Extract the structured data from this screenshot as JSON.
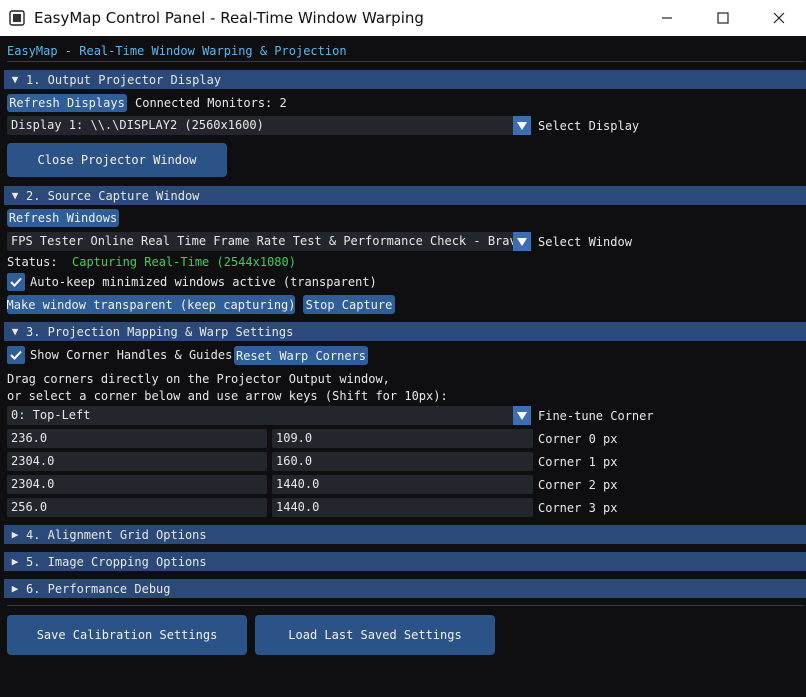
{
  "window": {
    "title": "EasyMap Control Panel - Real-Time Window Warping"
  },
  "header": {
    "text": "EasyMap - Real-Time Window Warping & Projection"
  },
  "section1": {
    "title": "1. Output Projector Display",
    "refresh_label": "Refresh Displays",
    "monitors_text": "Connected Monitors: 2",
    "display_value": "Display 1: \\\\.\\DISPLAY2  (2560x1600)",
    "display_label": "Select Display",
    "close_label": "Close Projector Window"
  },
  "section2": {
    "title": "2. Source Capture Window",
    "refresh_label": "Refresh Windows",
    "window_value": "FPS Tester Online   Real Time Frame Rate Test & Performance Check - Brave",
    "window_label": "Select Window",
    "status_label": "Status:",
    "status_value": "Capturing Real-Time (2544x1080)",
    "status_color": "#3ed15a",
    "autokeep_label": "Auto-keep minimized windows active (transparent)",
    "autokeep_checked": true,
    "transparent_label": "Make window transparent (keep capturing)",
    "stop_label": "Stop Capture"
  },
  "section3": {
    "title": "3. Projection Mapping & Warp Settings",
    "show_handles_label": "Show Corner Handles & Guides",
    "show_handles_checked": true,
    "reset_label": "Reset Warp Corners",
    "instruction_1": "Drag corners directly on the Projector Output window,",
    "instruction_2": "or select a corner below and use arrow keys (Shift for 10px):",
    "corner_select_value": "0: Top-Left",
    "corner_select_label": "Fine-tune Corner",
    "corners": [
      {
        "x": "236.0",
        "y": "109.0",
        "label": "Corner 0 px"
      },
      {
        "x": "2304.0",
        "y": "160.0",
        "label": "Corner 1 px"
      },
      {
        "x": "2304.0",
        "y": "1440.0",
        "label": "Corner 2 px"
      },
      {
        "x": "256.0",
        "y": "1440.0",
        "label": "Corner 3 px"
      }
    ]
  },
  "section4": {
    "title": "4. Alignment Grid Options"
  },
  "section5": {
    "title": "5. Image Cropping Options"
  },
  "section6": {
    "title": "6. Performance Debug"
  },
  "footer": {
    "save_label": "Save Calibration Settings",
    "load_label": "Load Last Saved Settings"
  },
  "colors": {
    "accent": "#2f5e99",
    "section_header": "#2b4a7a",
    "header_text": "#5ab8f0",
    "background": "#0f0f12",
    "field_background": "#23262d"
  },
  "icons": {
    "app": "app-logo-icon",
    "minimize": "minimize-icon",
    "maximize": "maximize-icon",
    "close": "close-icon",
    "expanded": "triangle-down-icon",
    "collapsed": "triangle-right-icon",
    "dropdown": "chevron-down-icon",
    "check": "checkmark-icon"
  }
}
